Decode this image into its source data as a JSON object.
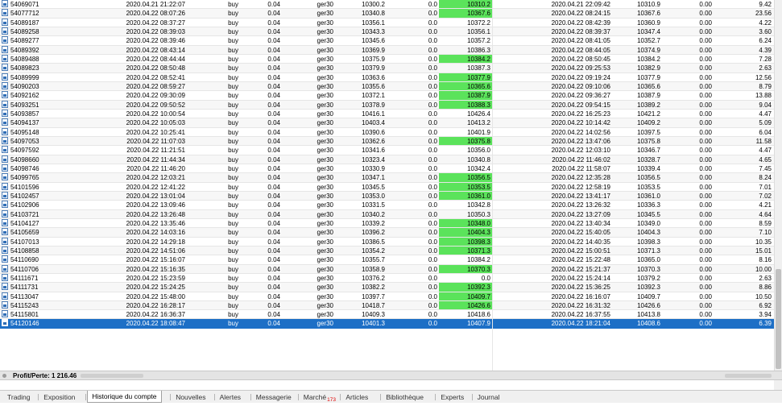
{
  "trades": [
    {
      "ticket": "54069071",
      "open_time": "2020.04.21 21:22:07",
      "type": "buy",
      "volume": "0.04",
      "symbol": "ger30",
      "open_price": "10300.2",
      "sl": "0.0",
      "tp": "10310.2",
      "tp_hl": true,
      "close_time": "2020.04.21 22:09:42",
      "close_price": "10310.9",
      "commission": "0.00",
      "profit": "9.42"
    },
    {
      "ticket": "54077712",
      "open_time": "2020.04.22 08:07:26",
      "type": "buy",
      "volume": "0.04",
      "symbol": "ger30",
      "open_price": "10340.8",
      "sl": "0.0",
      "tp": "10367.6",
      "tp_hl": true,
      "close_time": "2020.04.22 08:24:15",
      "close_price": "10367.6",
      "commission": "0.00",
      "profit": "23.56"
    },
    {
      "ticket": "54089187",
      "open_time": "2020.04.22 08:37:27",
      "type": "buy",
      "volume": "0.04",
      "symbol": "ger30",
      "open_price": "10356.1",
      "sl": "0.0",
      "tp": "10372.2",
      "tp_hl": false,
      "close_time": "2020.04.22 08:42:39",
      "close_price": "10360.9",
      "commission": "0.00",
      "profit": "4.22"
    },
    {
      "ticket": "54089258",
      "open_time": "2020.04.22 08:39:03",
      "type": "buy",
      "volume": "0.04",
      "symbol": "ger30",
      "open_price": "10343.3",
      "sl": "0.0",
      "tp": "10356.1",
      "tp_hl": false,
      "close_time": "2020.04.22 08:39:37",
      "close_price": "10347.4",
      "commission": "0.00",
      "profit": "3.60"
    },
    {
      "ticket": "54089277",
      "open_time": "2020.04.22 08:39:46",
      "type": "buy",
      "volume": "0.04",
      "symbol": "ger30",
      "open_price": "10345.6",
      "sl": "0.0",
      "tp": "10357.2",
      "tp_hl": false,
      "close_time": "2020.04.22 08:41:05",
      "close_price": "10352.7",
      "commission": "0.00",
      "profit": "6.24"
    },
    {
      "ticket": "54089392",
      "open_time": "2020.04.22 08:43:14",
      "type": "buy",
      "volume": "0.04",
      "symbol": "ger30",
      "open_price": "10369.9",
      "sl": "0.0",
      "tp": "10386.3",
      "tp_hl": false,
      "close_time": "2020.04.22 08:44:05",
      "close_price": "10374.9",
      "commission": "0.00",
      "profit": "4.39"
    },
    {
      "ticket": "54089488",
      "open_time": "2020.04.22 08:44:44",
      "type": "buy",
      "volume": "0.04",
      "symbol": "ger30",
      "open_price": "10375.9",
      "sl": "0.0",
      "tp": "10384.2",
      "tp_hl": true,
      "close_time": "2020.04.22 08:50:45",
      "close_price": "10384.2",
      "commission": "0.00",
      "profit": "7.28"
    },
    {
      "ticket": "54089823",
      "open_time": "2020.04.22 08:50:48",
      "type": "buy",
      "volume": "0.04",
      "symbol": "ger30",
      "open_price": "10379.9",
      "sl": "0.0",
      "tp": "10387.3",
      "tp_hl": false,
      "close_time": "2020.04.22 09:25:53",
      "close_price": "10382.9",
      "commission": "0.00",
      "profit": "2.63"
    },
    {
      "ticket": "54089999",
      "open_time": "2020.04.22 08:52:41",
      "type": "buy",
      "volume": "0.04",
      "symbol": "ger30",
      "open_price": "10363.6",
      "sl": "0.0",
      "tp": "10377.9",
      "tp_hl": true,
      "close_time": "2020.04.22 09:19:24",
      "close_price": "10377.9",
      "commission": "0.00",
      "profit": "12.56"
    },
    {
      "ticket": "54090203",
      "open_time": "2020.04.22 08:59:27",
      "type": "buy",
      "volume": "0.04",
      "symbol": "ger30",
      "open_price": "10355.6",
      "sl": "0.0",
      "tp": "10365.6",
      "tp_hl": true,
      "close_time": "2020.04.22 09:10:06",
      "close_price": "10365.6",
      "commission": "0.00",
      "profit": "8.79"
    },
    {
      "ticket": "54092162",
      "open_time": "2020.04.22 09:30:09",
      "type": "buy",
      "volume": "0.04",
      "symbol": "ger30",
      "open_price": "10372.1",
      "sl": "0.0",
      "tp": "10387.9",
      "tp_hl": true,
      "close_time": "2020.04.22 09:36:27",
      "close_price": "10387.9",
      "commission": "0.00",
      "profit": "13.88"
    },
    {
      "ticket": "54093251",
      "open_time": "2020.04.22 09:50:52",
      "type": "buy",
      "volume": "0.04",
      "symbol": "ger30",
      "open_price": "10378.9",
      "sl": "0.0",
      "tp": "10388.3",
      "tp_hl": true,
      "close_time": "2020.04.22 09:54:15",
      "close_price": "10389.2",
      "commission": "0.00",
      "profit": "9.04"
    },
    {
      "ticket": "54093857",
      "open_time": "2020.04.22 10:00:54",
      "type": "buy",
      "volume": "0.04",
      "symbol": "ger30",
      "open_price": "10416.1",
      "sl": "0.0",
      "tp": "10426.4",
      "tp_hl": false,
      "close_time": "2020.04.22 16:25:23",
      "close_price": "10421.2",
      "commission": "0.00",
      "profit": "4.47"
    },
    {
      "ticket": "54094137",
      "open_time": "2020.04.22 10:05:03",
      "type": "buy",
      "volume": "0.04",
      "symbol": "ger30",
      "open_price": "10403.4",
      "sl": "0.0",
      "tp": "10413.2",
      "tp_hl": false,
      "close_time": "2020.04.22 10:14:42",
      "close_price": "10409.2",
      "commission": "0.00",
      "profit": "5.09"
    },
    {
      "ticket": "54095148",
      "open_time": "2020.04.22 10:25:41",
      "type": "buy",
      "volume": "0.04",
      "symbol": "ger30",
      "open_price": "10390.6",
      "sl": "0.0",
      "tp": "10401.9",
      "tp_hl": false,
      "close_time": "2020.04.22 14:02:56",
      "close_price": "10397.5",
      "commission": "0.00",
      "profit": "6.04"
    },
    {
      "ticket": "54097053",
      "open_time": "2020.04.22 11:07:03",
      "type": "buy",
      "volume": "0.04",
      "symbol": "ger30",
      "open_price": "10362.6",
      "sl": "0.0",
      "tp": "10375.8",
      "tp_hl": true,
      "close_time": "2020.04.22 13:47:06",
      "close_price": "10375.8",
      "commission": "0.00",
      "profit": "11.58"
    },
    {
      "ticket": "54097592",
      "open_time": "2020.04.22 11:21:51",
      "type": "buy",
      "volume": "0.04",
      "symbol": "ger30",
      "open_price": "10341.6",
      "sl": "0.0",
      "tp": "10356.0",
      "tp_hl": false,
      "close_time": "2020.04.22 12:03:10",
      "close_price": "10346.7",
      "commission": "0.00",
      "profit": "4.47"
    },
    {
      "ticket": "54098660",
      "open_time": "2020.04.22 11:44:34",
      "type": "buy",
      "volume": "0.04",
      "symbol": "ger30",
      "open_price": "10323.4",
      "sl": "0.0",
      "tp": "10340.8",
      "tp_hl": false,
      "close_time": "2020.04.22 11:46:02",
      "close_price": "10328.7",
      "commission": "0.00",
      "profit": "4.65"
    },
    {
      "ticket": "54098746",
      "open_time": "2020.04.22 11:46:20",
      "type": "buy",
      "volume": "0.04",
      "symbol": "ger30",
      "open_price": "10330.9",
      "sl": "0.0",
      "tp": "10342.4",
      "tp_hl": false,
      "close_time": "2020.04.22 11:58:07",
      "close_price": "10339.4",
      "commission": "0.00",
      "profit": "7.45"
    },
    {
      "ticket": "54099765",
      "open_time": "2020.04.22 12:03:21",
      "type": "buy",
      "volume": "0.04",
      "symbol": "ger30",
      "open_price": "10347.1",
      "sl": "0.0",
      "tp": "10356.5",
      "tp_hl": true,
      "close_time": "2020.04.22 12:35:28",
      "close_price": "10356.5",
      "commission": "0.00",
      "profit": "8.24"
    },
    {
      "ticket": "54101596",
      "open_time": "2020.04.22 12:41:22",
      "type": "buy",
      "volume": "0.04",
      "symbol": "ger30",
      "open_price": "10345.5",
      "sl": "0.0",
      "tp": "10353.5",
      "tp_hl": true,
      "close_time": "2020.04.22 12:58:19",
      "close_price": "10353.5",
      "commission": "0.00",
      "profit": "7.01"
    },
    {
      "ticket": "54102457",
      "open_time": "2020.04.22 13:01:04",
      "type": "buy",
      "volume": "0.04",
      "symbol": "ger30",
      "open_price": "10353.0",
      "sl": "0.0",
      "tp": "10361.0",
      "tp_hl": true,
      "close_time": "2020.04.22 13:41:17",
      "close_price": "10361.0",
      "commission": "0.00",
      "profit": "7.02"
    },
    {
      "ticket": "54102906",
      "open_time": "2020.04.22 13:09:46",
      "type": "buy",
      "volume": "0.04",
      "symbol": "ger30",
      "open_price": "10331.5",
      "sl": "0.0",
      "tp": "10342.8",
      "tp_hl": false,
      "close_time": "2020.04.22 13:26:32",
      "close_price": "10336.3",
      "commission": "0.00",
      "profit": "4.21"
    },
    {
      "ticket": "54103721",
      "open_time": "2020.04.22 13:26:48",
      "type": "buy",
      "volume": "0.04",
      "symbol": "ger30",
      "open_price": "10340.2",
      "sl": "0.0",
      "tp": "10350.3",
      "tp_hl": false,
      "close_time": "2020.04.22 13:27:09",
      "close_price": "10345.5",
      "commission": "0.00",
      "profit": "4.64"
    },
    {
      "ticket": "54104127",
      "open_time": "2020.04.22 13:35:46",
      "type": "buy",
      "volume": "0.04",
      "symbol": "ger30",
      "open_price": "10339.2",
      "sl": "0.0",
      "tp": "10348.0",
      "tp_hl": true,
      "close_time": "2020.04.22 13:40:34",
      "close_price": "10349.0",
      "commission": "0.00",
      "profit": "8.59"
    },
    {
      "ticket": "54105659",
      "open_time": "2020.04.22 14:03:16",
      "type": "buy",
      "volume": "0.04",
      "symbol": "ger30",
      "open_price": "10396.2",
      "sl": "0.0",
      "tp": "10404.3",
      "tp_hl": true,
      "close_time": "2020.04.22 15:40:05",
      "close_price": "10404.3",
      "commission": "0.00",
      "profit": "7.10"
    },
    {
      "ticket": "54107013",
      "open_time": "2020.04.22 14:29:18",
      "type": "buy",
      "volume": "0.04",
      "symbol": "ger30",
      "open_price": "10386.5",
      "sl": "0.0",
      "tp": "10398.3",
      "tp_hl": true,
      "close_time": "2020.04.22 14:40:35",
      "close_price": "10398.3",
      "commission": "0.00",
      "profit": "10.35"
    },
    {
      "ticket": "54108858",
      "open_time": "2020.04.22 14:51:06",
      "type": "buy",
      "volume": "0.04",
      "symbol": "ger30",
      "open_price": "10354.2",
      "sl": "0.0",
      "tp": "10371.3",
      "tp_hl": true,
      "close_time": "2020.04.22 15:00:51",
      "close_price": "10371.3",
      "commission": "0.00",
      "profit": "15.01"
    },
    {
      "ticket": "54110690",
      "open_time": "2020.04.22 15:16:07",
      "type": "buy",
      "volume": "0.04",
      "symbol": "ger30",
      "open_price": "10355.7",
      "sl": "0.0",
      "tp": "10384.2",
      "tp_hl": false,
      "close_time": "2020.04.22 15:22:48",
      "close_price": "10365.0",
      "commission": "0.00",
      "profit": "8.16"
    },
    {
      "ticket": "54110706",
      "open_time": "2020.04.22 15:16:35",
      "type": "buy",
      "volume": "0.04",
      "symbol": "ger30",
      "open_price": "10358.9",
      "sl": "0.0",
      "tp": "10370.3",
      "tp_hl": true,
      "close_time": "2020.04.22 15:21:37",
      "close_price": "10370.3",
      "commission": "0.00",
      "profit": "10.00"
    },
    {
      "ticket": "54111671",
      "open_time": "2020.04.22 15:23:59",
      "type": "buy",
      "volume": "0.04",
      "symbol": "ger30",
      "open_price": "10376.2",
      "sl": "0.0",
      "tp": "0.0",
      "tp_hl": false,
      "close_time": "2020.04.22 15:24:14",
      "close_price": "10379.2",
      "commission": "0.00",
      "profit": "2.63"
    },
    {
      "ticket": "54111731",
      "open_time": "2020.04.22 15:24:25",
      "type": "buy",
      "volume": "0.04",
      "symbol": "ger30",
      "open_price": "10382.2",
      "sl": "0.0",
      "tp": "10392.3",
      "tp_hl": true,
      "close_time": "2020.04.22 15:36:25",
      "close_price": "10392.3",
      "commission": "0.00",
      "profit": "8.86"
    },
    {
      "ticket": "54113047",
      "open_time": "2020.04.22 15:48:00",
      "type": "buy",
      "volume": "0.04",
      "symbol": "ger30",
      "open_price": "10397.7",
      "sl": "0.0",
      "tp": "10409.7",
      "tp_hl": true,
      "close_time": "2020.04.22 16:16:07",
      "close_price": "10409.7",
      "commission": "0.00",
      "profit": "10.50"
    },
    {
      "ticket": "54115243",
      "open_time": "2020.04.22 16:28:17",
      "type": "buy",
      "volume": "0.04",
      "symbol": "ger30",
      "open_price": "10418.7",
      "sl": "0.0",
      "tp": "10426.6",
      "tp_hl": true,
      "close_time": "2020.04.22 16:31:32",
      "close_price": "10426.6",
      "commission": "0.00",
      "profit": "6.92"
    },
    {
      "ticket": "54115801",
      "open_time": "2020.04.22 16:36:37",
      "type": "buy",
      "volume": "0.04",
      "symbol": "ger30",
      "open_price": "10409.3",
      "sl": "0.0",
      "tp": "10418.6",
      "tp_hl": false,
      "close_time": "2020.04.22 16:37:55",
      "close_price": "10413.8",
      "commission": "0.00",
      "profit": "3.94"
    },
    {
      "ticket": "54120146",
      "open_time": "2020.04.22 18:08:47",
      "type": "buy",
      "volume": "0.04",
      "symbol": "ger30",
      "open_price": "10401.3",
      "sl": "0.0",
      "tp": "10407.9",
      "tp_hl": true,
      "close_time": "2020.04.22 18:21:04",
      "close_price": "10408.6",
      "commission": "0.00",
      "profit": "6.39",
      "selected": true
    }
  ],
  "summary": {
    "label": "Profit/Perte: 1 216.46"
  },
  "tabs": [
    {
      "label": "Trading"
    },
    {
      "label": "Exposition"
    },
    {
      "label": "Historique du compte",
      "active": true
    },
    {
      "label": "Nouvelles"
    },
    {
      "label": "Alertes"
    },
    {
      "label": "Messagerie"
    },
    {
      "label": "Marché",
      "badge": "173"
    },
    {
      "label": "Articles"
    },
    {
      "label": "Bibliothèque"
    },
    {
      "label": "Experts"
    },
    {
      "label": "Journal"
    }
  ],
  "colors": {
    "tp_highlight": "#5be35b",
    "selection": "#1d6fc6",
    "badge": "#e00000"
  },
  "icons": {
    "row": "document-icon"
  }
}
